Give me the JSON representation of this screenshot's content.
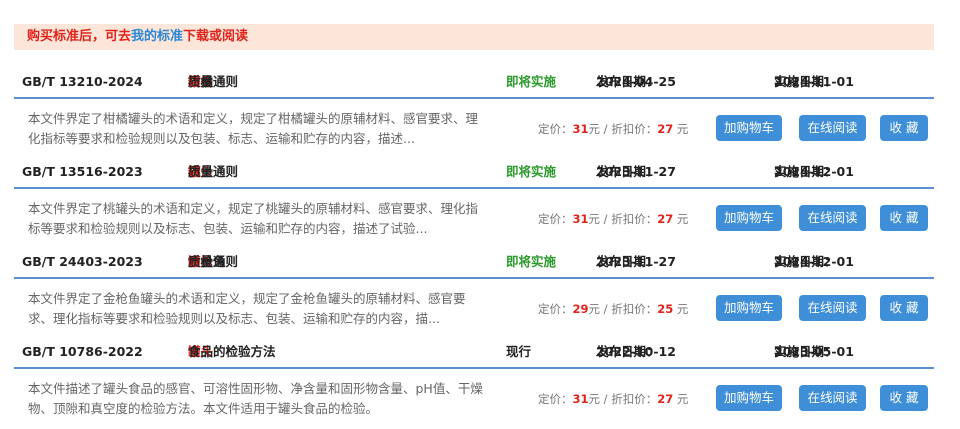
{
  "notice": {
    "prefix": "购买标准后，可去",
    "link": "我的标准",
    "suffix": "下载或阅读"
  },
  "labels": {
    "pub_date_label": "发布日期：",
    "impl_date_label": "实施日期：",
    "list_price_label": "定价：",
    "discount_label": "元 / 折扣价：",
    "yuan": " 元",
    "add_cart": "加购物车",
    "read_online": "在线阅读",
    "favorite": "收 藏"
  },
  "items": [
    {
      "code": "GB/T 13210-2024",
      "title_pre": "柑橘",
      "title_hl": "罐头",
      "title_post": "质量通则",
      "status": "即将实施",
      "pub_date": "2024-04-25",
      "impl_date": "2024-11-01",
      "desc": "本文件界定了柑橘罐头的术语和定义，规定了柑橘罐头的原辅材料、感官要求、理化指标等要求和检验规则以及包装、标志、运输和贮存的内容，描述...",
      "list_price": "31",
      "discount_price": "27"
    },
    {
      "code": "GB/T 13516-2023",
      "title_pre": "桃",
      "title_hl": "罐头",
      "title_post": "质量通则",
      "status": "即将实施",
      "pub_date": "2023-11-27",
      "impl_date": "2024-12-01",
      "desc": "本文件界定了桃罐头的术语和定义，规定了桃罐头的原辅材料、感官要求、理化指标等要求和检验规则以及标志、包装、运输和贮存的内容，描述了试验...",
      "list_price": "31",
      "discount_price": "27"
    },
    {
      "code": "GB/T 24403-2023",
      "title_pre": "金枪鱼",
      "title_hl": "罐头",
      "title_post": "质量通则",
      "status": "即将实施",
      "pub_date": "2023-11-27",
      "impl_date": "2024-12-01",
      "desc": "本文件界定了金枪鱼罐头的术语和定义，规定了金枪鱼罐头的原辅材料、感官要求、理化指标等要求和检验规则以及标志、包装、运输和贮存的内容，描...",
      "list_price": "29",
      "discount_price": "25"
    },
    {
      "code": "GB/T 10786-2022",
      "title_pre": "",
      "title_hl": "罐头",
      "title_post": "食品的检验方法",
      "status": "现行",
      "pub_date": "2022-10-12",
      "impl_date": "2023-05-01",
      "desc": "本文件描述了罐头食品的感官、可溶性固形物、净含量和固形物含量、pH值、干燥物、顶隙和真空度的检验方法。本文件适用于罐头食品的检验。",
      "list_price": "31",
      "discount_price": "27"
    }
  ],
  "colors": {
    "accent": "#3f8fd8",
    "highlight": "#e0241c",
    "upcoming": "#2c9a2c",
    "notice_bg": "#fbe6d9"
  }
}
